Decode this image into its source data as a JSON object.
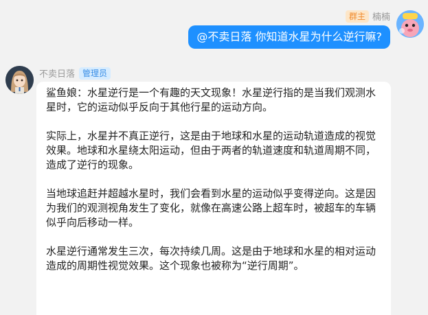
{
  "outgoing": {
    "role_badge": "群主",
    "sender_name": "楠楠",
    "avatar_icon": "cartoon-avatar-icon",
    "text": "@不卖日落 你知道水星为什么逆行嘛?"
  },
  "incoming": {
    "sender_name": "不卖日落",
    "role_badge": "管理员",
    "avatar_icon": "anime-girl-avatar-icon",
    "paragraphs": [
      "鲨鱼娘：水星逆行是一个有趣的天文现象！水星逆行指的是当我们观测水星时，它的运动似乎反向于其他行星的运动方向。",
      "实际上，水星并不真正逆行，这是由于地球和水星的运动轨道造成的视觉效果。地球和水星绕太阳运动，但由于两者的轨道速度和轨道周期不同，造成了逆行的现象。",
      "当地球追赶并超越水星时，我们会看到水星的运动似乎变得逆向。这是因为我们的观测视角发生了变化，就像在高速公路上超车时，被超车的车辆似乎向后移动一样。",
      "水星逆行通常发生三次，每次持续几周。这是由于地球和水星的相对运动造成的周期性视觉效果。这个现象也被称为“逆行周期”。"
    ]
  },
  "colors": {
    "bubble_out": "#1e90ff",
    "bubble_in": "#ffffff",
    "background": "#f2f2f2",
    "owner_badge_bg": "#fde6c8",
    "owner_badge_text": "#f08a2c",
    "admin_badge_bg": "#d6ecff",
    "admin_badge_text": "#3a8ee6"
  }
}
